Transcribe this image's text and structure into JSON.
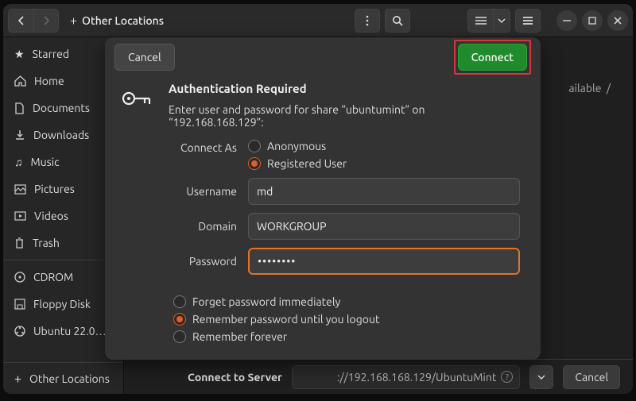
{
  "header": {
    "location": "Other Locations"
  },
  "sidebar": {
    "items": [
      {
        "label": "Starred",
        "icon": "star-icon"
      },
      {
        "label": "Home",
        "icon": "home-icon"
      },
      {
        "label": "Documents",
        "icon": "document-icon"
      },
      {
        "label": "Downloads",
        "icon": "download-icon"
      },
      {
        "label": "Music",
        "icon": "music-icon"
      },
      {
        "label": "Pictures",
        "icon": "picture-icon"
      },
      {
        "label": "Videos",
        "icon": "video-icon"
      },
      {
        "label": "Trash",
        "icon": "trash-icon"
      }
    ],
    "devices": [
      {
        "label": "CDROM",
        "icon": "disc-icon"
      },
      {
        "label": "Floppy Disk",
        "icon": "floppy-icon"
      },
      {
        "label": "Ubuntu 22.0…",
        "icon": "ubuntu-icon"
      }
    ],
    "footer": "Other Locations"
  },
  "content": {
    "available_text": "ailable",
    "connect_label": "Connect to Server",
    "address": "://192.168.168.129/UbuntuMint",
    "cancel": "Cancel"
  },
  "dialog": {
    "cancel": "Cancel",
    "connect": "Connect",
    "title": "Authentication Required",
    "subtitle": "Enter user and password for share “ubuntumint” on “192.168.168.129”:",
    "connect_as_label": "Connect As",
    "anonymous": "Anonymous",
    "registered": "Registered User",
    "username_label": "Username",
    "username_value": "md",
    "domain_label": "Domain",
    "domain_value": "WORKGROUP",
    "password_label": "Password",
    "password_value": "••••••••",
    "remember": {
      "opt1": "Forget password immediately",
      "opt2": "Remember password until you logout",
      "opt3": "Remember forever",
      "selected": 1
    }
  }
}
